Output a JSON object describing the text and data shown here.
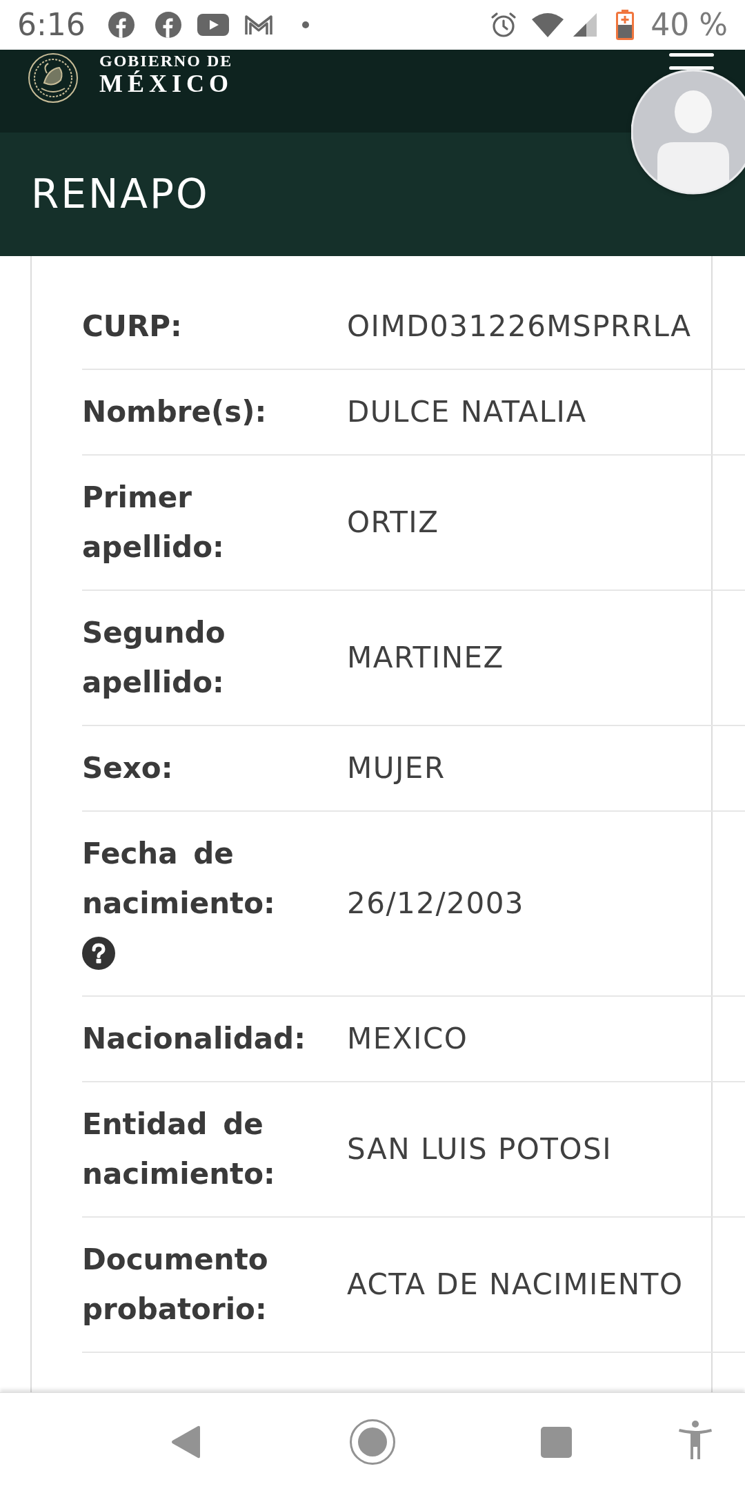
{
  "status_bar": {
    "time": "6:16",
    "battery": "40 %"
  },
  "header": {
    "wordmark_top": "GOBIERNO DE",
    "wordmark_main": "MÉXICO"
  },
  "section": {
    "title": "RENAPO"
  },
  "record": {
    "rows": [
      {
        "label": "CURP:",
        "value": "OIMD031226MSPRRLA",
        "help": false
      },
      {
        "label": "Nombre(s):",
        "value": "DULCE NATALIA",
        "help": false
      },
      {
        "label": "Primer apellido:",
        "value": "ORTIZ",
        "help": false
      },
      {
        "label": "Segundo apellido:",
        "value": "MARTINEZ",
        "help": false
      },
      {
        "label": "Sexo:",
        "value": "MUJER",
        "help": false
      },
      {
        "label": "Fecha de nacimiento:",
        "value": "26/12/2003",
        "help": true
      },
      {
        "label": "Nacionalidad:",
        "value": "MEXICO",
        "help": false
      },
      {
        "label": "Entidad de nacimiento:",
        "value": "SAN LUIS POTOSI",
        "help": false
      },
      {
        "label": "Documento probatorio:",
        "value": "ACTA DE NACIMIENTO",
        "help": false
      }
    ]
  }
}
